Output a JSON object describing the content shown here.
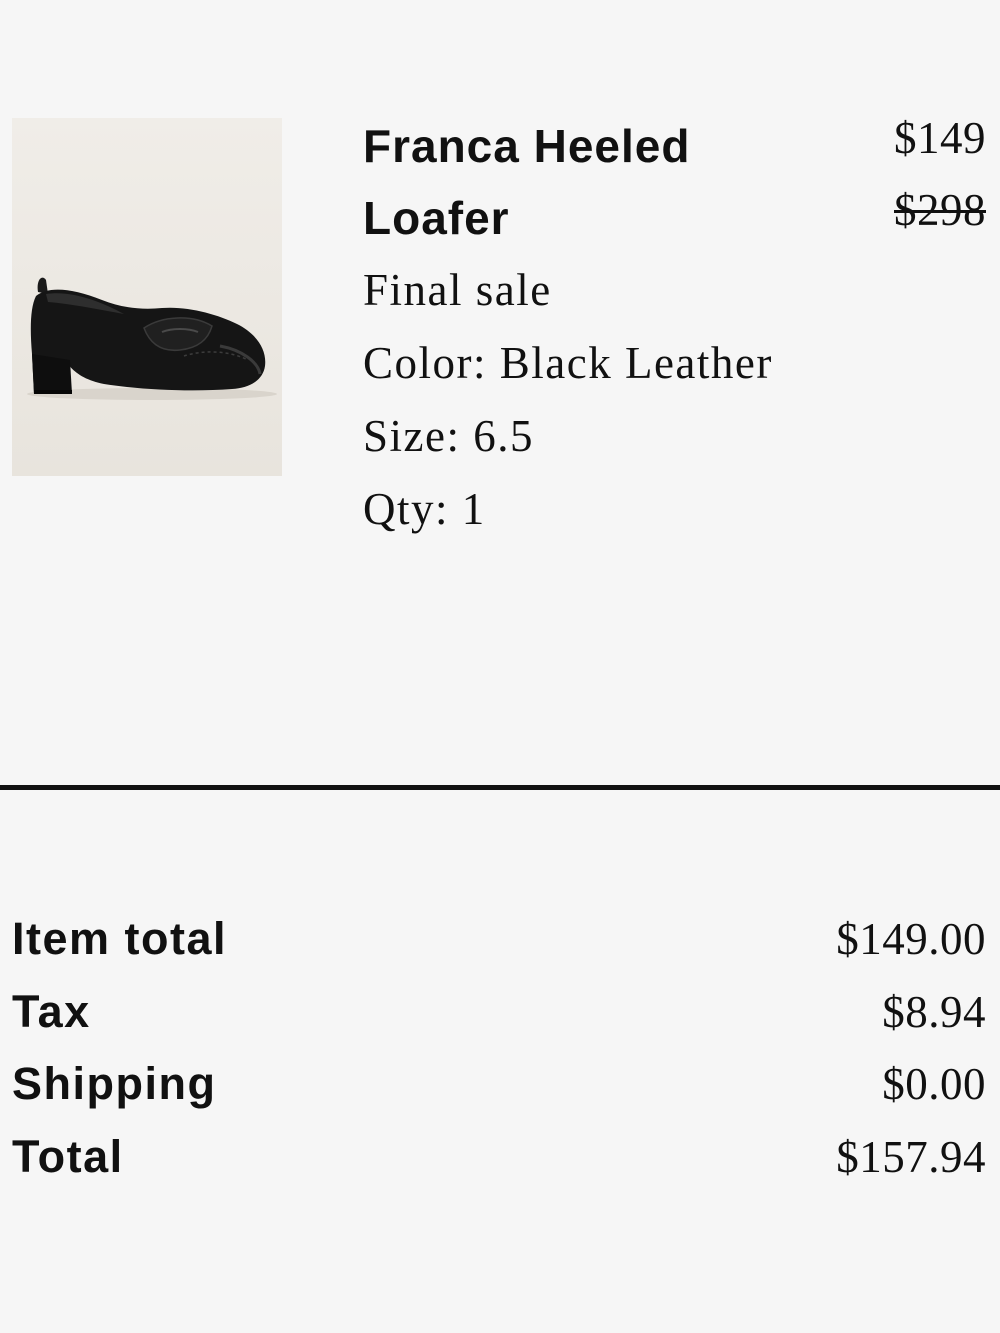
{
  "item": {
    "image_icon": "loafer-product-photo",
    "name": "Franca Heeled Loafer",
    "price_sale": "$149",
    "price_original": "$298",
    "final_sale": "Final sale",
    "color": "Color: Black Leather",
    "size": "Size: 6.5",
    "qty": "Qty: 1"
  },
  "summary": {
    "rows": [
      {
        "label": "Item total",
        "value": "$149.00"
      },
      {
        "label": "Tax",
        "value": "$8.94"
      },
      {
        "label": "Shipping",
        "value": "$0.00"
      },
      {
        "label": "Total",
        "value": "$157.94"
      }
    ]
  },
  "colors": {
    "background": "#f6f6f6",
    "text": "#111111",
    "image_background": "#eeebe5"
  }
}
